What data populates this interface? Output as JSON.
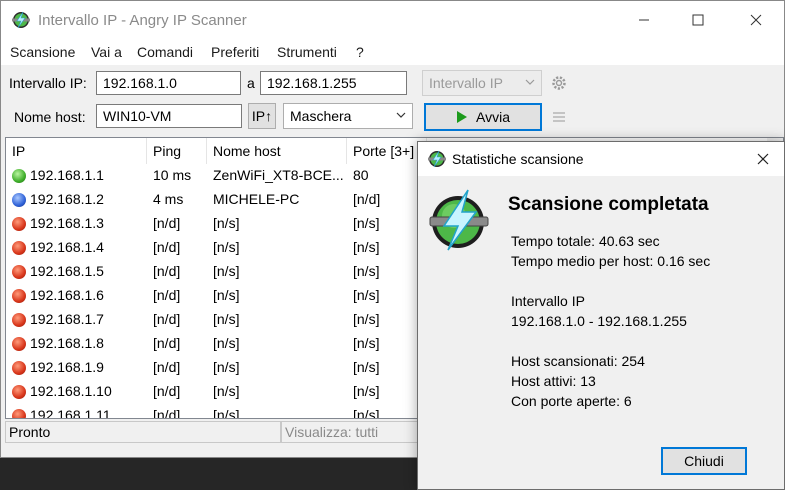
{
  "window": {
    "title": "Intervallo IP - Angry IP Scanner"
  },
  "menu": [
    "Scansione",
    "Vai a",
    "Comandi",
    "Preferiti",
    "Strumenti",
    "?"
  ],
  "toolbar": {
    "range_label": "Intervallo IP:",
    "range_from": "192.168.1.0",
    "range_to_label": "a",
    "range_to": "192.168.1.255",
    "feeder_select": "Intervallo IP",
    "hostname_label": "Nome host:",
    "hostname_value": "WIN10-VM",
    "ip_up_button": "IP↑",
    "netmask_select": "Maschera",
    "start_button": "Avvia"
  },
  "table": {
    "columns": [
      "IP",
      "Ping",
      "Nome host",
      "Porte [3+]"
    ],
    "rows": [
      {
        "status": "green",
        "ip": "192.168.1.1",
        "ping": "10 ms",
        "host": "ZenWiFi_XT8-BCE...",
        "ports": "80"
      },
      {
        "status": "blue",
        "ip": "192.168.1.2",
        "ping": "4 ms",
        "host": "MICHELE-PC",
        "ports": "[n/d]"
      },
      {
        "status": "red",
        "ip": "192.168.1.3",
        "ping": "[n/d]",
        "host": "[n/s]",
        "ports": "[n/s]"
      },
      {
        "status": "red",
        "ip": "192.168.1.4",
        "ping": "[n/d]",
        "host": "[n/s]",
        "ports": "[n/s]"
      },
      {
        "status": "red",
        "ip": "192.168.1.5",
        "ping": "[n/d]",
        "host": "[n/s]",
        "ports": "[n/s]"
      },
      {
        "status": "red",
        "ip": "192.168.1.6",
        "ping": "[n/d]",
        "host": "[n/s]",
        "ports": "[n/s]"
      },
      {
        "status": "red",
        "ip": "192.168.1.7",
        "ping": "[n/d]",
        "host": "[n/s]",
        "ports": "[n/s]"
      },
      {
        "status": "red",
        "ip": "192.168.1.8",
        "ping": "[n/d]",
        "host": "[n/s]",
        "ports": "[n/s]"
      },
      {
        "status": "red",
        "ip": "192.168.1.9",
        "ping": "[n/d]",
        "host": "[n/s]",
        "ports": "[n/s]"
      },
      {
        "status": "red",
        "ip": "192.168.1.10",
        "ping": "[n/d]",
        "host": "[n/s]",
        "ports": "[n/s]"
      },
      {
        "status": "red",
        "ip": "192.168.1.11",
        "ping": "[n/d]",
        "host": "[n/s]",
        "ports": "[n/s]"
      }
    ]
  },
  "status": {
    "left": "Pronto",
    "display": "Visualizza: tutti"
  },
  "dialog": {
    "title": "Statistiche scansione",
    "heading": "Scansione completata",
    "total_time": "Tempo totale: 40.63 sec",
    "avg_time": "Tempo medio per host: 0.16 sec",
    "range_label": "Intervallo IP",
    "range_value": "192.168.1.0 - 192.168.1.255",
    "hosts_scanned": "Host scansionati: 254",
    "hosts_alive": "Host attivi: 13",
    "open_ports": "Con porte aperte: 6",
    "close_button": "Chiudi"
  },
  "colors": {
    "accent": "#0078d7",
    "green": "#3fae2a",
    "blue": "#2f62d8",
    "red": "#d8351a"
  }
}
